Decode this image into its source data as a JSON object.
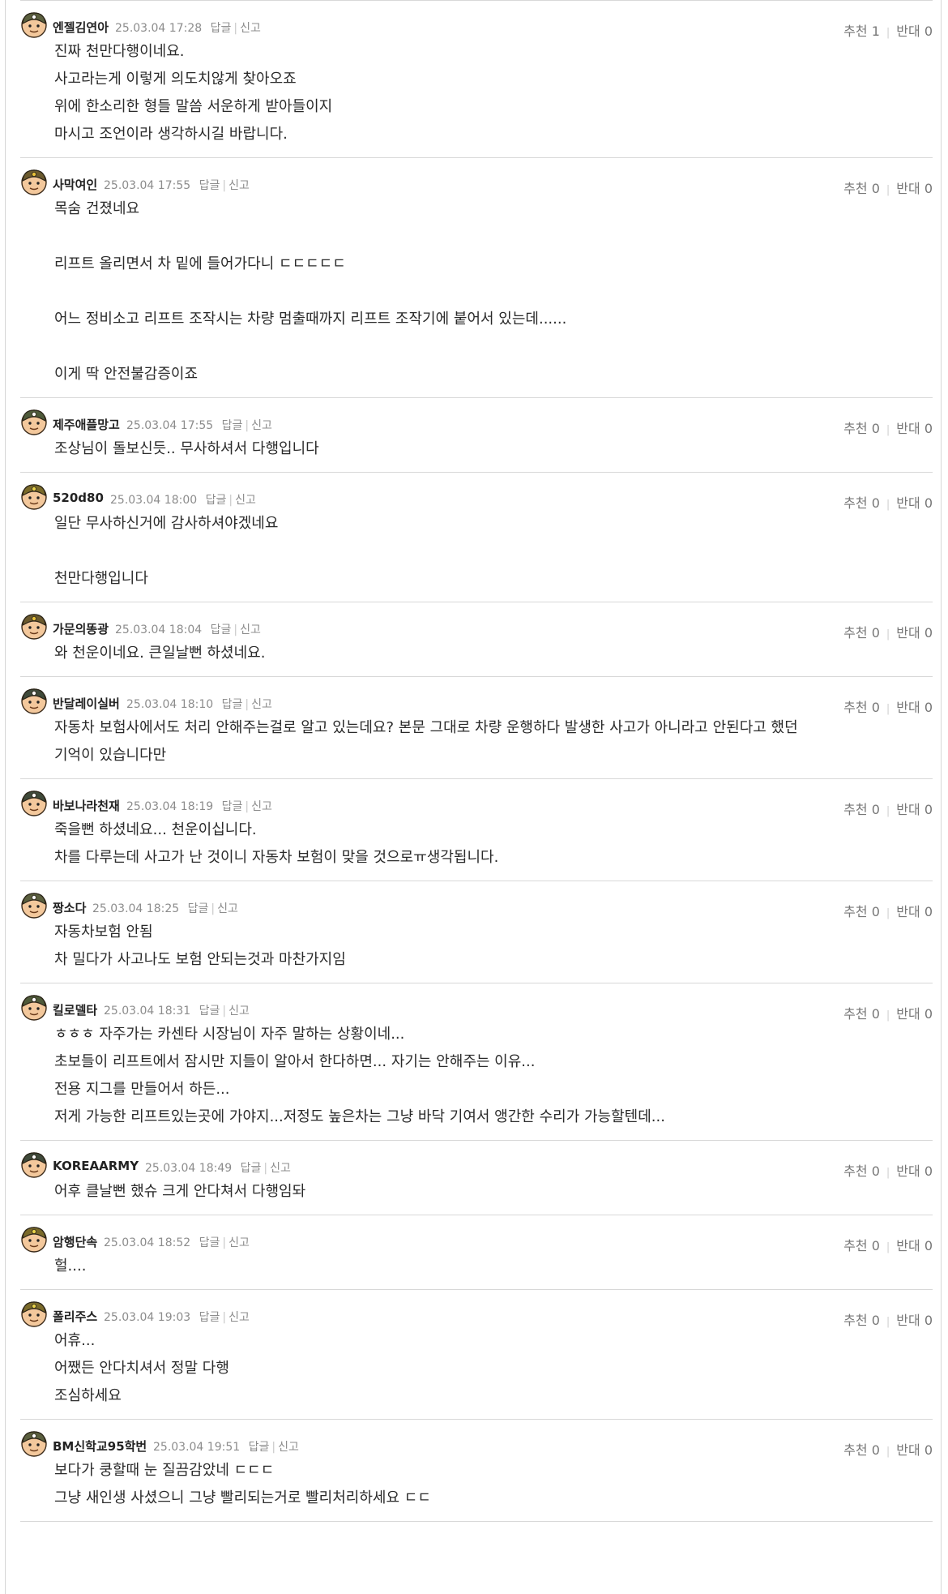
{
  "labels": {
    "reply": "답글",
    "report": "신고",
    "recommend": "추천",
    "oppose": "반대"
  },
  "comments": [
    {
      "nick": "엔젤김연아",
      "date": "25.03.04 17:28",
      "up": "1",
      "down": "0",
      "avatar": "avatar-a",
      "lines": [
        "진짜 천만다행이네요.",
        "사고라는게 이렇게 의도치않게 찾아오죠",
        "위에 한소리한 형들 말씀 서운하게 받아들이지",
        "마시고 조언이라 생각하시길 바랍니다."
      ]
    },
    {
      "nick": "사막여인",
      "date": "25.03.04 17:55",
      "up": "0",
      "down": "0",
      "avatar": "avatar-b",
      "lines": [
        "목숨 건졌네요",
        "",
        "리프트 올리면서 차 밑에 들어가다니 ㄷㄷㄷㄷㄷ",
        "",
        "어느 정비소고 리프트 조작시는 차량 멈출때까지 리프트 조작기에 붙어서 있는데......",
        "",
        "이게 딱 안전불감증이죠"
      ]
    },
    {
      "nick": "제주애플망고",
      "date": "25.03.04 17:55",
      "up": "0",
      "down": "0",
      "avatar": "avatar-c",
      "lines": [
        "조상님이 돌보신듯.. 무사하셔서 다행입니다"
      ]
    },
    {
      "nick": "520d80",
      "date": "25.03.04 18:00",
      "up": "0",
      "down": "0",
      "avatar": "avatar-d",
      "lines": [
        "일단 무사하신거에 감사하셔야겠네요",
        "",
        "천만다행입니다"
      ]
    },
    {
      "nick": "가문의똥광",
      "date": "25.03.04 18:04",
      "up": "0",
      "down": "0",
      "avatar": "avatar-b",
      "lines": [
        "와 천운이네요. 큰일날뻔 하셨네요."
      ]
    },
    {
      "nick": "반달레이실버",
      "date": "25.03.04 18:10",
      "up": "0",
      "down": "0",
      "avatar": "avatar-e",
      "lines": [
        "자동차 보험사에서도 처리 안해주는걸로 알고 있는데요? 본문 그대로 차량 운행하다 발생한 사고가 아니라고 안된다고 했던",
        "기억이 있습니다만"
      ]
    },
    {
      "nick": "바보나라천재",
      "date": "25.03.04 18:19",
      "up": "0",
      "down": "0",
      "avatar": "avatar-e",
      "lines": [
        "죽을뻔 하셨네요... 천운이십니다.",
        "차를 다루는데 사고가 난 것이니 자동차 보험이 맞을 것으로ㅠ생각됩니다."
      ]
    },
    {
      "nick": "짱소다",
      "date": "25.03.04 18:25",
      "up": "0",
      "down": "0",
      "avatar": "avatar-a",
      "lines": [
        "자동차보험 안됨",
        "차 밀다가 사고나도 보험 안되는것과 마찬가지임"
      ]
    },
    {
      "nick": "킬로델타",
      "date": "25.03.04 18:31",
      "up": "0",
      "down": "0",
      "avatar": "avatar-c",
      "lines": [
        "ㅎㅎㅎ 자주가는 카센타 시장님이 자주 말하는 상황이네...",
        "초보들이 리프트에서 잠시만 지들이 알아서 한다하면... 자기는 안해주는 이유...",
        "전용 지그를 만들어서 하든...",
        "저게 가능한 리프트있는곳에 가야지...저정도 높은차는 그냥 바닥 기여서 앵간한 수리가 가능할텐데..."
      ]
    },
    {
      "nick": "KOREAARMY",
      "date": "25.03.04 18:49",
      "up": "0",
      "down": "0",
      "avatar": "avatar-e",
      "lines": [
        "어후 클날뻔 했슈 크게 안다쳐서 다행임돠"
      ]
    },
    {
      "nick": "암행단속",
      "date": "25.03.04 18:52",
      "up": "0",
      "down": "0",
      "avatar": "avatar-d",
      "lines": [
        "헐...."
      ]
    },
    {
      "nick": "폴리주스",
      "date": "25.03.04 19:03",
      "up": "0",
      "down": "0",
      "avatar": "avatar-d",
      "lines": [
        "어휴...",
        "어쨌든 안다치셔서 정말 다행",
        "조심하세요"
      ]
    },
    {
      "nick": "BM신학교95학번",
      "date": "25.03.04 19:51",
      "up": "0",
      "down": "0",
      "avatar": "avatar-a",
      "lines": [
        "보다가 쿵할때 눈 질끔감았네 ㄷㄷㄷ",
        "그냥 새인생 사셨으니 그냥 빨리되는거로 빨리처리하세요 ㄷㄷ"
      ]
    }
  ],
  "colors": {
    "text": "#2a2a2a",
    "meta": "#8c8c8c",
    "divider": "#d8d8d8"
  }
}
